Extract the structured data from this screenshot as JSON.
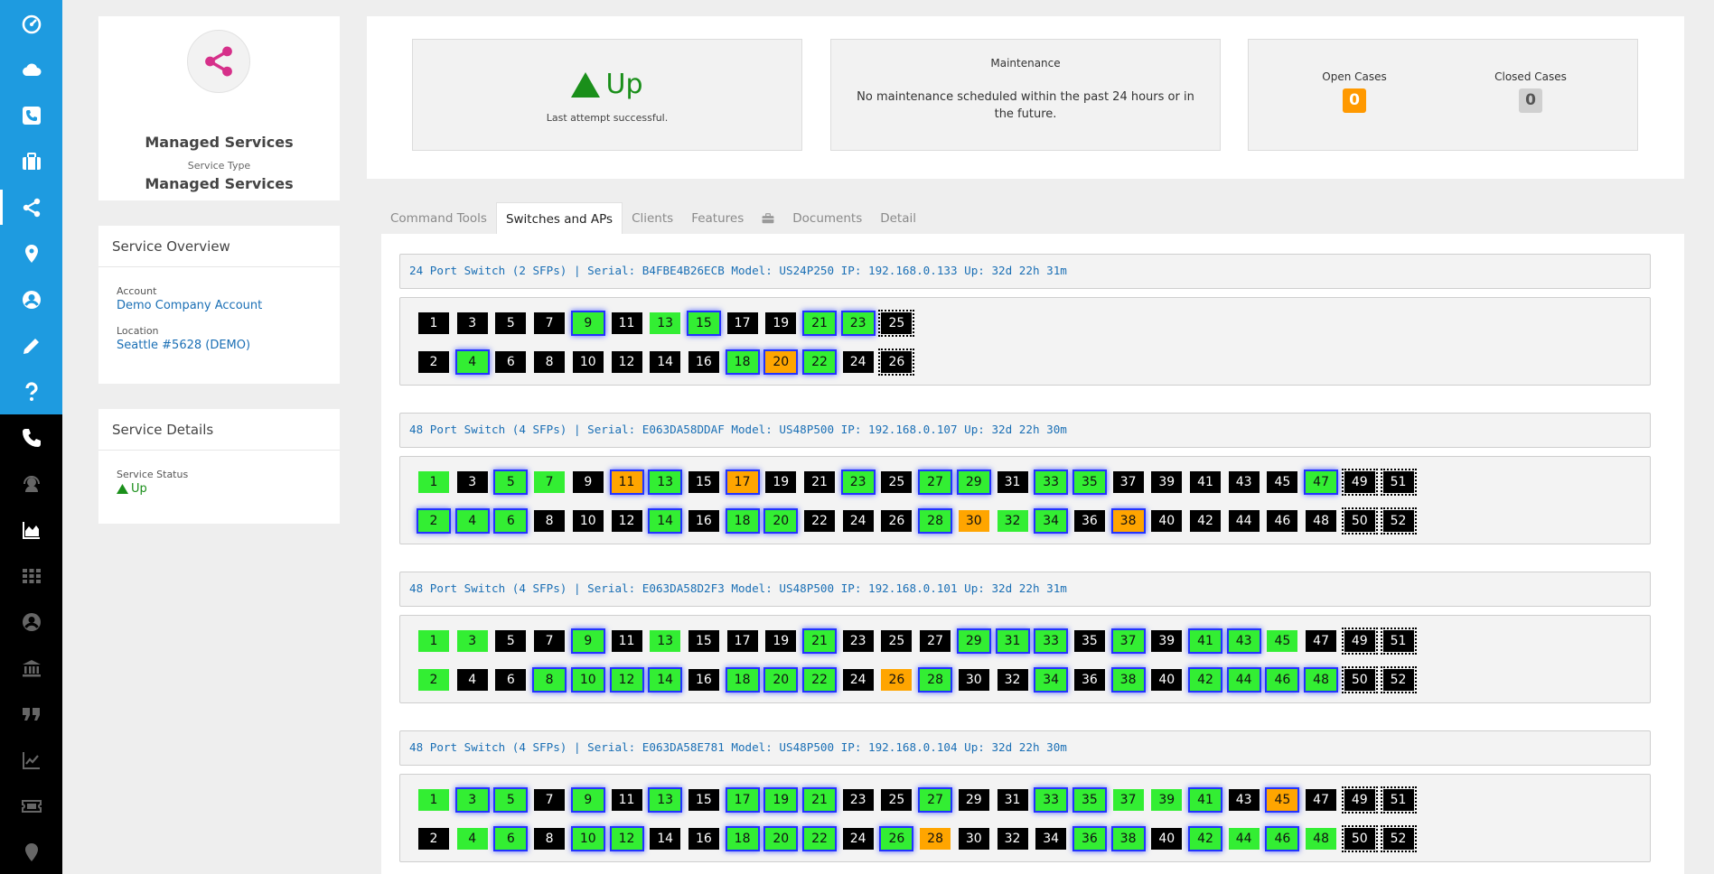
{
  "service": {
    "name": "Managed Services",
    "type_label": "Service Type",
    "type": "Managed Services"
  },
  "overview": {
    "title": "Service Overview",
    "account_label": "Account",
    "account": "Demo Company Account",
    "location_label": "Location",
    "location": "Seattle #5628 (DEMO)"
  },
  "details": {
    "title": "Service Details",
    "status_label": "Service Status",
    "status": "Up"
  },
  "summary": {
    "status": "Up",
    "status_sub": "Last attempt successful.",
    "maint_title": "Maintenance",
    "maint_text": "No maintenance scheduled within the past 24 hours or in the future.",
    "open_label": "Open Cases",
    "open_count": "0",
    "closed_label": "Closed Cases",
    "closed_count": "0"
  },
  "tabs": [
    {
      "label": "Command Tools"
    },
    {
      "label": "Switches and APs",
      "active": true
    },
    {
      "label": "Clients"
    },
    {
      "label": "Features"
    },
    {
      "label": "",
      "icon": "briefcase-icon"
    },
    {
      "label": "Documents"
    },
    {
      "label": "Detail"
    }
  ],
  "colors": {
    "rail_blue": "#1e9be0",
    "port_up": "#33ee33",
    "port_warn": "#ffa500",
    "port_down": "#000000",
    "poe_glow": "#2233ff",
    "status_green": "#1a8f1a",
    "open_badge": "#ff9900",
    "closed_badge": "#d0d0d0"
  },
  "switches": [
    {
      "header": "24 Port Switch (2 SFPs) | Serial: B4FBE4B26ECB Model: US24P250 IP: 192.168.0.133 Up: 32d 22h 31m",
      "ports": 26,
      "sfp": [
        25,
        26
      ],
      "green": [
        9,
        13,
        15,
        21,
        23,
        4,
        18,
        22
      ],
      "orange": [
        20
      ],
      "poe": [
        9,
        15,
        21,
        23,
        4,
        18,
        20,
        22
      ]
    },
    {
      "header": "48 Port Switch (4 SFPs) | Serial: E063DA58DDAF Model: US48P500 IP: 192.168.0.107 Up: 32d 22h 30m",
      "ports": 52,
      "sfp": [
        49,
        50,
        51,
        52
      ],
      "green": [
        1,
        5,
        7,
        13,
        23,
        27,
        29,
        33,
        35,
        47,
        2,
        4,
        6,
        14,
        18,
        20,
        28,
        32,
        34
      ],
      "orange": [
        11,
        17,
        30,
        38
      ],
      "poe": [
        5,
        11,
        13,
        17,
        23,
        27,
        29,
        33,
        35,
        47,
        2,
        4,
        6,
        14,
        18,
        20,
        28,
        34,
        38
      ]
    },
    {
      "header": "48 Port Switch (4 SFPs) | Serial: E063DA58D2F3 Model: US48P500 IP: 192.168.0.101 Up: 32d 22h 31m",
      "ports": 52,
      "sfp": [
        49,
        50,
        51,
        52
      ],
      "green": [
        1,
        3,
        9,
        13,
        21,
        29,
        31,
        33,
        37,
        41,
        43,
        45,
        2,
        8,
        10,
        12,
        14,
        18,
        20,
        22,
        28,
        34,
        38,
        42,
        44,
        46,
        48
      ],
      "orange": [
        26
      ],
      "poe": [
        9,
        21,
        29,
        31,
        33,
        37,
        41,
        43,
        8,
        10,
        12,
        14,
        18,
        20,
        22,
        28,
        34,
        38,
        42,
        44,
        46,
        48
      ]
    },
    {
      "header": "48 Port Switch (4 SFPs) | Serial: E063DA58E781 Model: US48P500 IP: 192.168.0.104 Up: 32d 22h 30m",
      "ports": 52,
      "sfp": [
        49,
        50,
        51,
        52
      ],
      "green": [
        1,
        3,
        5,
        9,
        13,
        17,
        19,
        21,
        27,
        33,
        35,
        37,
        39,
        41,
        4,
        6,
        10,
        12,
        18,
        20,
        22,
        26,
        36,
        38,
        42,
        44,
        46,
        48
      ],
      "orange": [
        45,
        28
      ],
      "poe": [
        3,
        5,
        9,
        13,
        17,
        19,
        21,
        27,
        33,
        35,
        41,
        45,
        6,
        10,
        12,
        18,
        20,
        22,
        26,
        36,
        38,
        42,
        46
      ]
    }
  ]
}
